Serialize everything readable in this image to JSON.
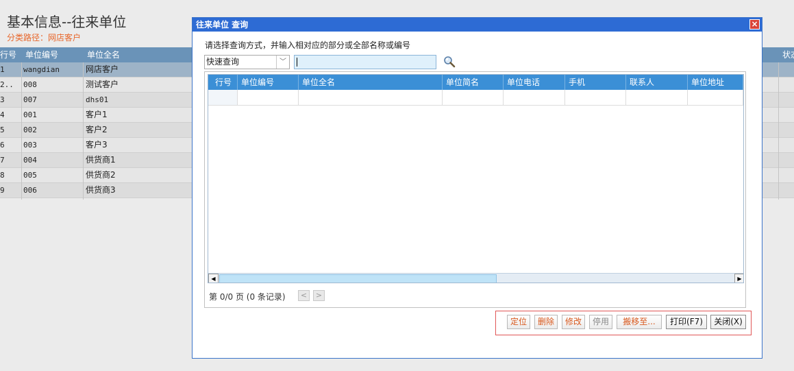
{
  "page": {
    "title": "基本信息--往来单位",
    "path_label": "分类路径：",
    "path_value": "网店客户"
  },
  "bg_table": {
    "headers": {
      "row_no": "行号",
      "code": "单位编号",
      "name": "单位全名",
      "status": "状态"
    },
    "rows": [
      {
        "no": "1",
        "code": "wangdian",
        "name": "网店客户"
      },
      {
        "no": "2..",
        "code": "008",
        "name": "测试客户"
      },
      {
        "no": "3",
        "code": "007",
        "name": "dhs01"
      },
      {
        "no": "4",
        "code": "001",
        "name": "客户1"
      },
      {
        "no": "5",
        "code": "002",
        "name": "客户2"
      },
      {
        "no": "6",
        "code": "003",
        "name": "客户3"
      },
      {
        "no": "7",
        "code": "004",
        "name": "供货商1"
      },
      {
        "no": "8",
        "code": "005",
        "name": "供货商2"
      },
      {
        "no": "9",
        "code": "006",
        "name": "供货商3"
      }
    ]
  },
  "dialog": {
    "title": "往来单位 查询",
    "close_symbol": "×",
    "instruction": "请选择查询方式，并输入相对应的部分或全部名称或编号",
    "query_mode": "快速查询",
    "query_mode_arrow": "﹀",
    "search_value": "",
    "grid_headers": {
      "row_no": "行号",
      "code": "单位编号",
      "full_name": "单位全名",
      "short_name": "单位简名",
      "phone": "单位电话",
      "mobile": "手机",
      "contact": "联系人",
      "address": "单位地址"
    },
    "pager": {
      "text": "第 0/0 页 (0 条记录)",
      "prev": "<",
      "next": ">"
    },
    "scroll": {
      "left": "◀",
      "right": "▶"
    },
    "buttons": {
      "locate": "定位",
      "delete": "删除",
      "edit": "修改",
      "disable": "停用",
      "move_to": "搬移至...",
      "print": "打印(F7)",
      "close": "关闭(X)"
    }
  },
  "colors": {
    "dialog_title_bar": "#2d6bd4",
    "grid_header": "#3b8fd6",
    "action_text": "#d8591e",
    "button_group_border": "#e05555",
    "path_text": "#e8662a"
  }
}
